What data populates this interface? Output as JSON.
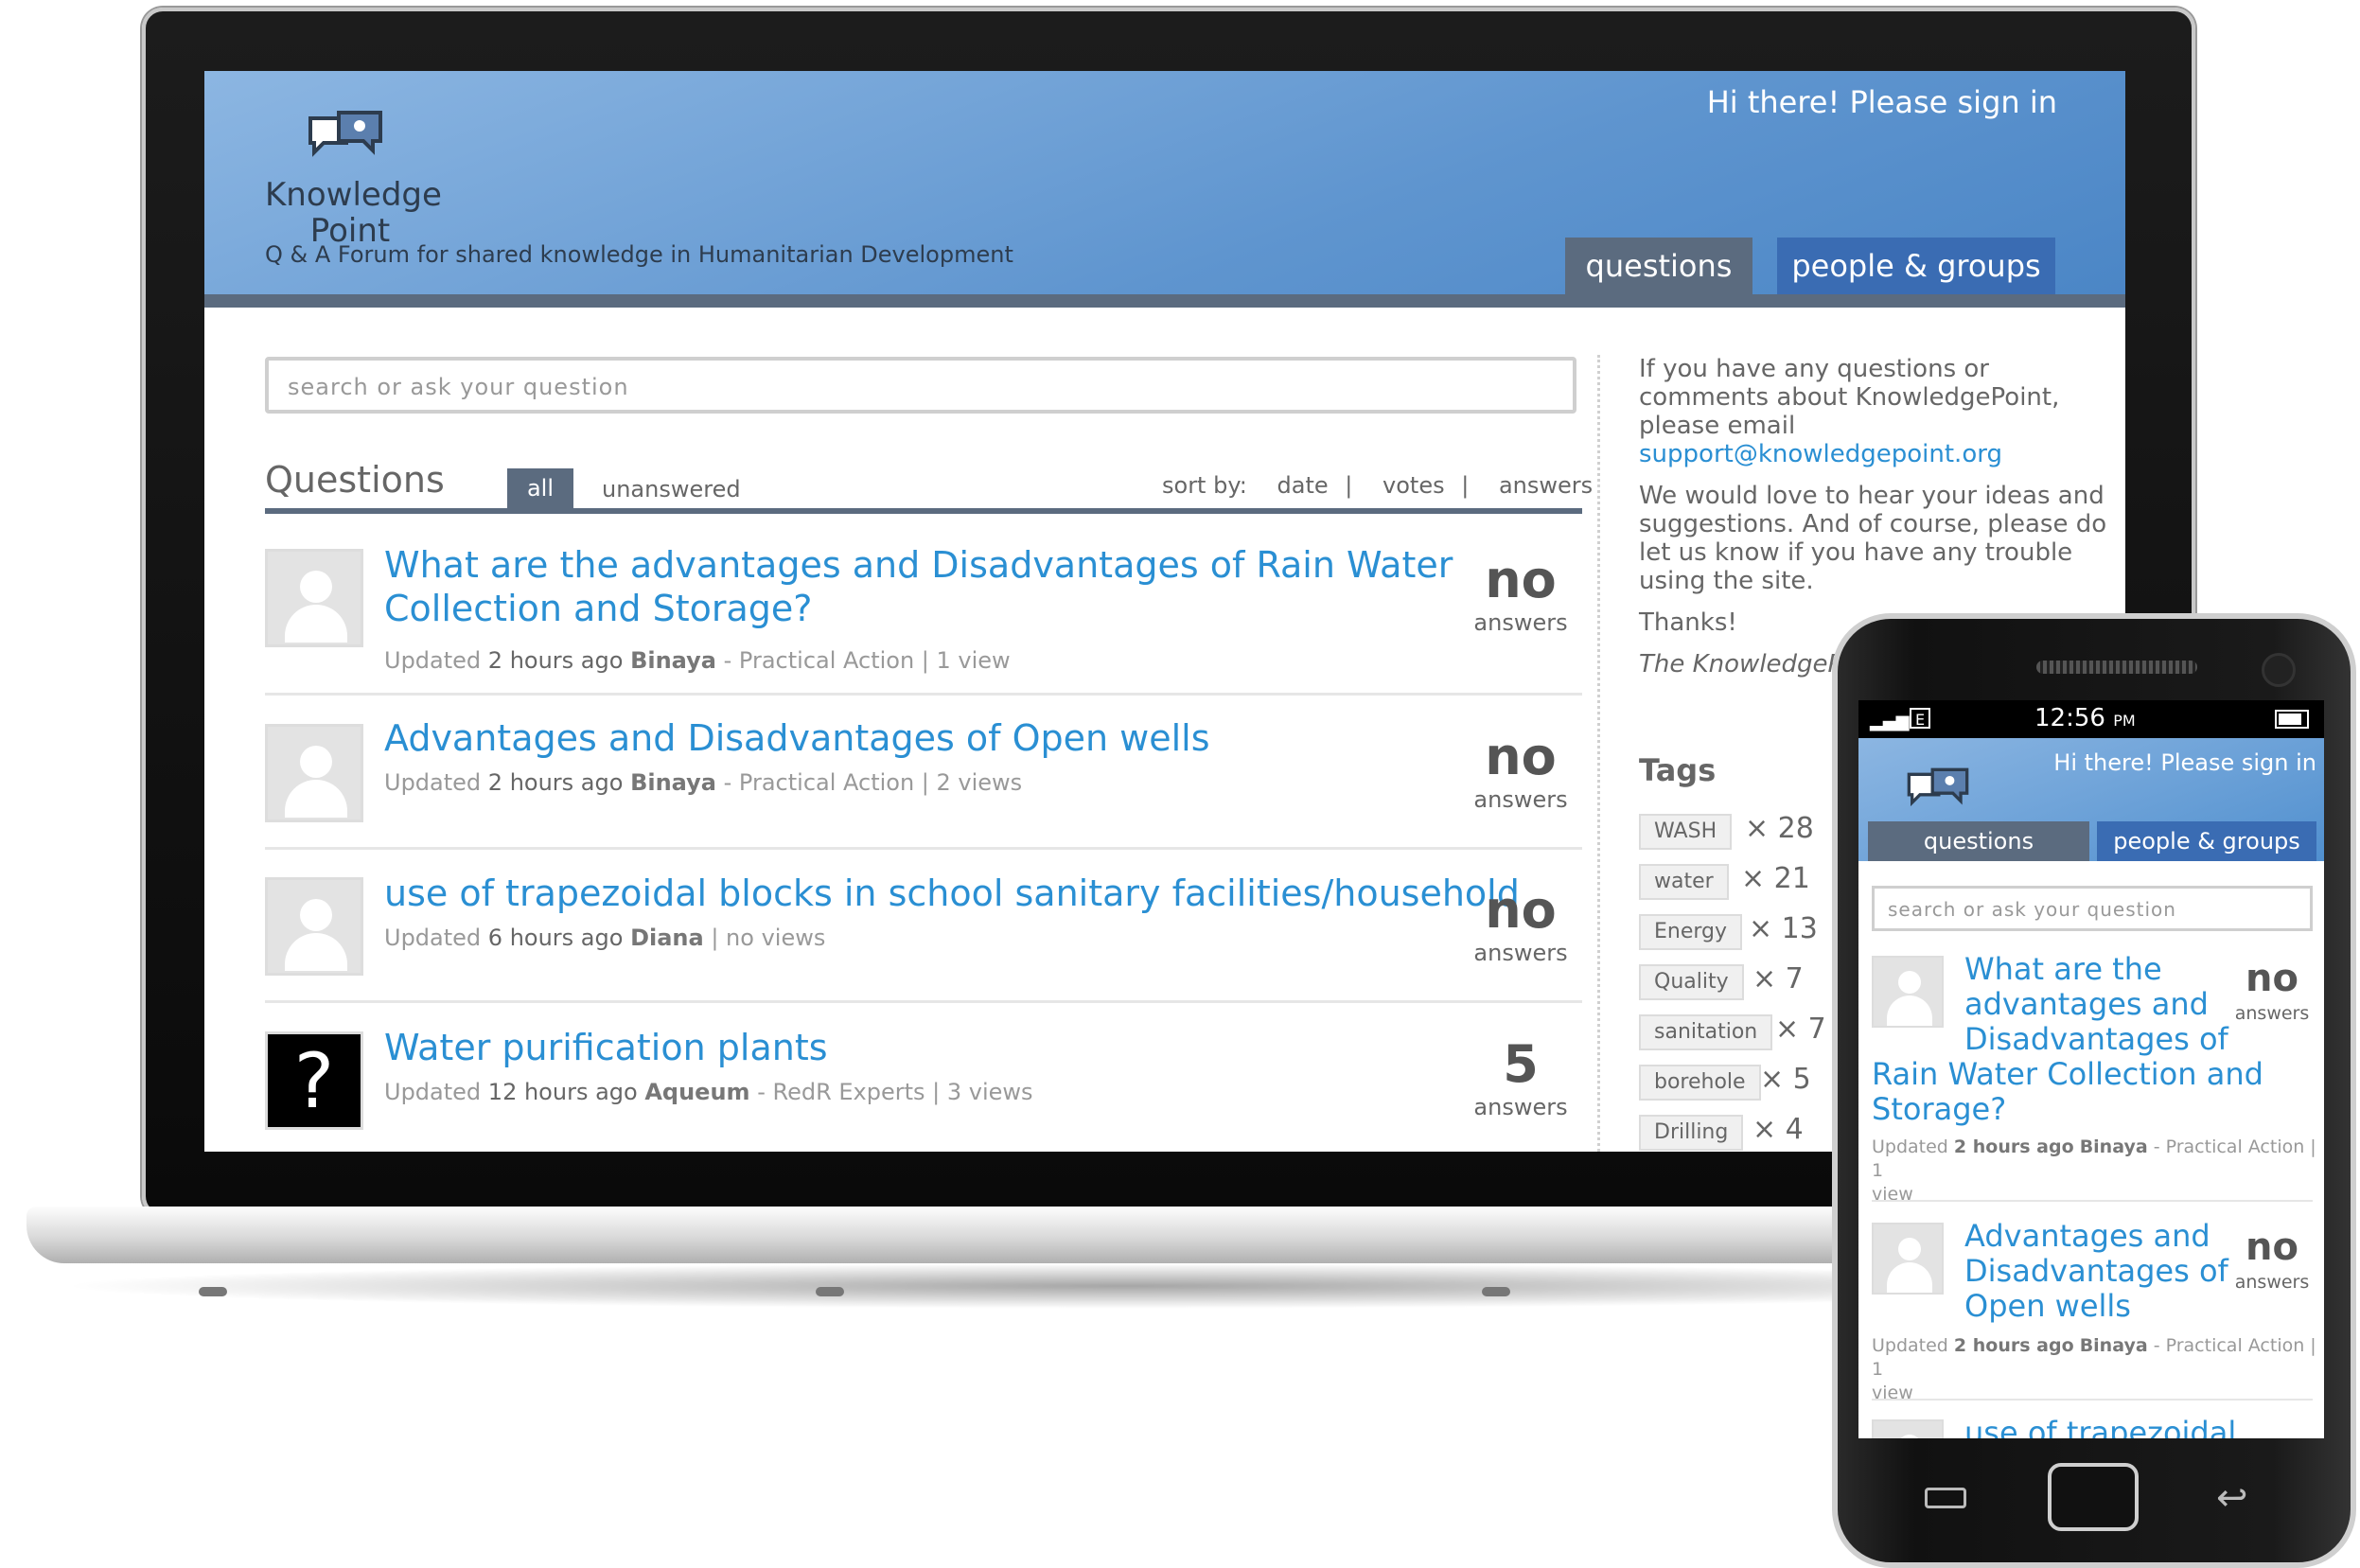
{
  "desktop": {
    "header": {
      "signin": "Hi there! Please sign in",
      "logo_line1": "Knowledge",
      "logo_line2": "Point",
      "tagline": "Q & A Forum for shared knowledge in Humanitarian Development",
      "tabs": [
        "questions",
        "people & groups"
      ]
    },
    "search_placeholder": "search or ask your question",
    "questions_title": "Questions",
    "filters": {
      "all": "all",
      "unanswered": "unanswered"
    },
    "sort": {
      "label": "sort by:",
      "date": "date",
      "votes": "votes",
      "answers": "answers",
      "sep": "|"
    },
    "questions": [
      {
        "title_line1": "What are the advantages and Disadvantages of Rain Water",
        "title_line2": "Collection and Storage?",
        "updated": "Updated",
        "time": "2 hours ago",
        "user": "Binaya",
        "org": "- Practical Action | 1 view",
        "count": "no",
        "label": "answers"
      },
      {
        "title_line1": "Advantages and Disadvantages of Open wells",
        "updated": "Updated",
        "time": "2 hours ago",
        "user": "Binaya",
        "org": "- Practical Action | 2 views",
        "count": "no",
        "label": "answers"
      },
      {
        "title_line1": "use of trapezoidal blocks in school sanitary facilities/household",
        "updated": "Updated",
        "time": "6 hours ago",
        "user": "Diana",
        "org": "| no views",
        "count": "no",
        "label": "answers"
      },
      {
        "title_line1": "Water purification plants",
        "updated": "Updated",
        "time": "12 hours ago",
        "user": "Aqueum",
        "org": "- RedR Experts | 3 views",
        "count": "5",
        "label": "answers"
      }
    ],
    "sidebar": {
      "p1": "If you have any questions or comments about KnowledgePoint, please email",
      "email": "support@knowledgepoint.org",
      "p2": "We would love to hear your ideas and suggestions. And of course, please do let us know if you have any trouble using the site.",
      "thanks": "Thanks!",
      "signoff": "The KnowledgePoint Team",
      "tags_title": "Tags",
      "tags": [
        {
          "name": "WASH",
          "count": "× 28"
        },
        {
          "name": "water",
          "count": "× 21"
        },
        {
          "name": "Energy",
          "count": "× 13"
        },
        {
          "name": "Quality",
          "count": "× 7"
        },
        {
          "name": "sanitation",
          "count": "× 7"
        },
        {
          "name": "borehole",
          "count": "× 5"
        },
        {
          "name": "Drilling",
          "count": "× 4"
        }
      ]
    }
  },
  "mobile": {
    "status_time": "12:56",
    "status_ampm": "PM",
    "status_network": "E",
    "signin": "Hi there! Please sign in",
    "tabs": [
      "questions",
      "people & groups"
    ],
    "search_placeholder": "search or ask your question",
    "questions": [
      {
        "t1": "What are the",
        "t2": "advantages and",
        "t3": "Disadvantages of",
        "t4": "Rain Water Collection and",
        "t5": "Storage?",
        "updated": "Updated",
        "time": "2 hours ago",
        "user": "Binaya",
        "org": "- Practical Action | 1",
        "org2": "view",
        "count": "no",
        "label": "answers"
      },
      {
        "t1": "Advantages and",
        "t2": "Disadvantages of",
        "t3": "Open wells",
        "updated": "Updated",
        "time": "2 hours ago",
        "user": "Binaya",
        "org": "- Practical Action | 1",
        "org2": "view",
        "count": "no",
        "label": "answers"
      },
      {
        "t1": "use of trapezoidal"
      }
    ]
  }
}
